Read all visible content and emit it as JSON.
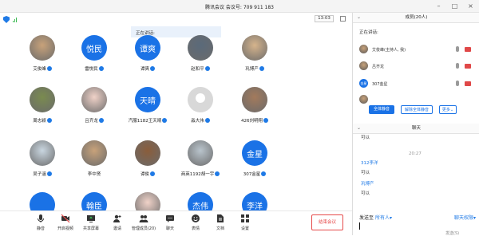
{
  "window": {
    "title": "腾讯会议 会议号: 709 911 183"
  },
  "meeting": {
    "clock": "13:03",
    "speaking_label": "正在讲话:"
  },
  "participants": [
    {
      "name": "艾俊峰",
      "avatar_text": "",
      "avatar_kind": "photo",
      "mic": true
    },
    {
      "name": "雷悦民",
      "avatar_text": "悦民",
      "avatar_kind": "text",
      "mic": true
    },
    {
      "name": "谭爽",
      "avatar_text": "谭爽",
      "avatar_kind": "text",
      "mic": true
    },
    {
      "name": "赵和平",
      "avatar_text": "",
      "avatar_kind": "photo",
      "mic": true
    },
    {
      "name": "巩博产",
      "avatar_text": "",
      "avatar_kind": "photo",
      "mic": true
    },
    {
      "name": "周志颖",
      "avatar_text": "",
      "avatar_kind": "photo",
      "mic": true
    },
    {
      "name": "吕齐龙",
      "avatar_text": "",
      "avatar_kind": "photo",
      "mic": true
    },
    {
      "name": "汽服1182王天晴",
      "avatar_text": "天晴",
      "avatar_kind": "text",
      "mic": true
    },
    {
      "name": "淼大伟",
      "avatar_text": "",
      "avatar_kind": "default",
      "mic": true
    },
    {
      "name": "426刘明翔",
      "avatar_text": "",
      "avatar_kind": "photo",
      "mic": true
    },
    {
      "name": "吴子涵",
      "avatar_text": "",
      "avatar_kind": "photo",
      "mic": true
    },
    {
      "name": "李中贤",
      "avatar_text": "",
      "avatar_kind": "photo",
      "mic": false
    },
    {
      "name": "谭俊",
      "avatar_text": "",
      "avatar_kind": "photo",
      "mic": true
    },
    {
      "name": "商英1192胡一宇",
      "avatar_text": "",
      "avatar_kind": "photo",
      "mic": true
    },
    {
      "name": "307金星",
      "avatar_text": "金星",
      "avatar_kind": "text",
      "mic": true
    },
    {
      "name": "",
      "avatar_text": "",
      "avatar_kind": "text",
      "mic": false
    },
    {
      "name": "",
      "avatar_text": "翰臣",
      "avatar_kind": "text",
      "mic": false
    },
    {
      "name": "",
      "avatar_text": "",
      "avatar_kind": "photo",
      "mic": false
    },
    {
      "name": "",
      "avatar_text": "杰伟",
      "avatar_kind": "text",
      "mic": false
    },
    {
      "name": "",
      "avatar_text": "李洋",
      "avatar_kind": "text",
      "mic": false
    }
  ],
  "toolbar": {
    "items": [
      {
        "label": "静音",
        "icon": "microphone-icon"
      },
      {
        "label": "开启视频",
        "icon": "video-camera-icon"
      },
      {
        "label": "共享屏幕",
        "icon": "share-screen-icon"
      },
      {
        "label": "邀请",
        "icon": "invite-icon"
      },
      {
        "label": "管理成员(20)",
        "icon": "members-icon"
      },
      {
        "label": "聊天",
        "icon": "chat-icon"
      },
      {
        "label": "表情",
        "icon": "emoji-icon"
      },
      {
        "label": "文档",
        "icon": "document-icon"
      },
      {
        "label": "设置",
        "icon": "settings-icon"
      }
    ],
    "end_label": "结束会议"
  },
  "members_panel": {
    "title": "成员(20人)",
    "speaking_label": "正在讲话:",
    "members": [
      {
        "name": "艾俊峰(主持人, 我)",
        "avatar_text": ""
      },
      {
        "name": "吕齐龙",
        "avatar_text": ""
      },
      {
        "name": "307金星",
        "avatar_text": "金星"
      },
      {
        "name": "",
        "avatar_text": ""
      }
    ],
    "mute_all": "全体静音",
    "unmute_all": "解除全体静音",
    "more": "更多"
  },
  "chat_panel": {
    "title": "聊天",
    "messages": [
      {
        "kind": "text",
        "text": "可以"
      },
      {
        "kind": "time",
        "text": "20:27"
      },
      {
        "kind": "sender",
        "text": "312李洋"
      },
      {
        "kind": "text",
        "text": "可以"
      },
      {
        "kind": "sender",
        "text": "巩博产"
      },
      {
        "kind": "text",
        "text": "可以"
      }
    ],
    "send_to_label": "发送至",
    "send_to_value": "所有人",
    "permission": "聊天权限",
    "send_button": "发送(S)"
  },
  "colors": {
    "accent": "#1a72e6",
    "end": "#e64a4a",
    "panel_bg": "#fafafa"
  }
}
